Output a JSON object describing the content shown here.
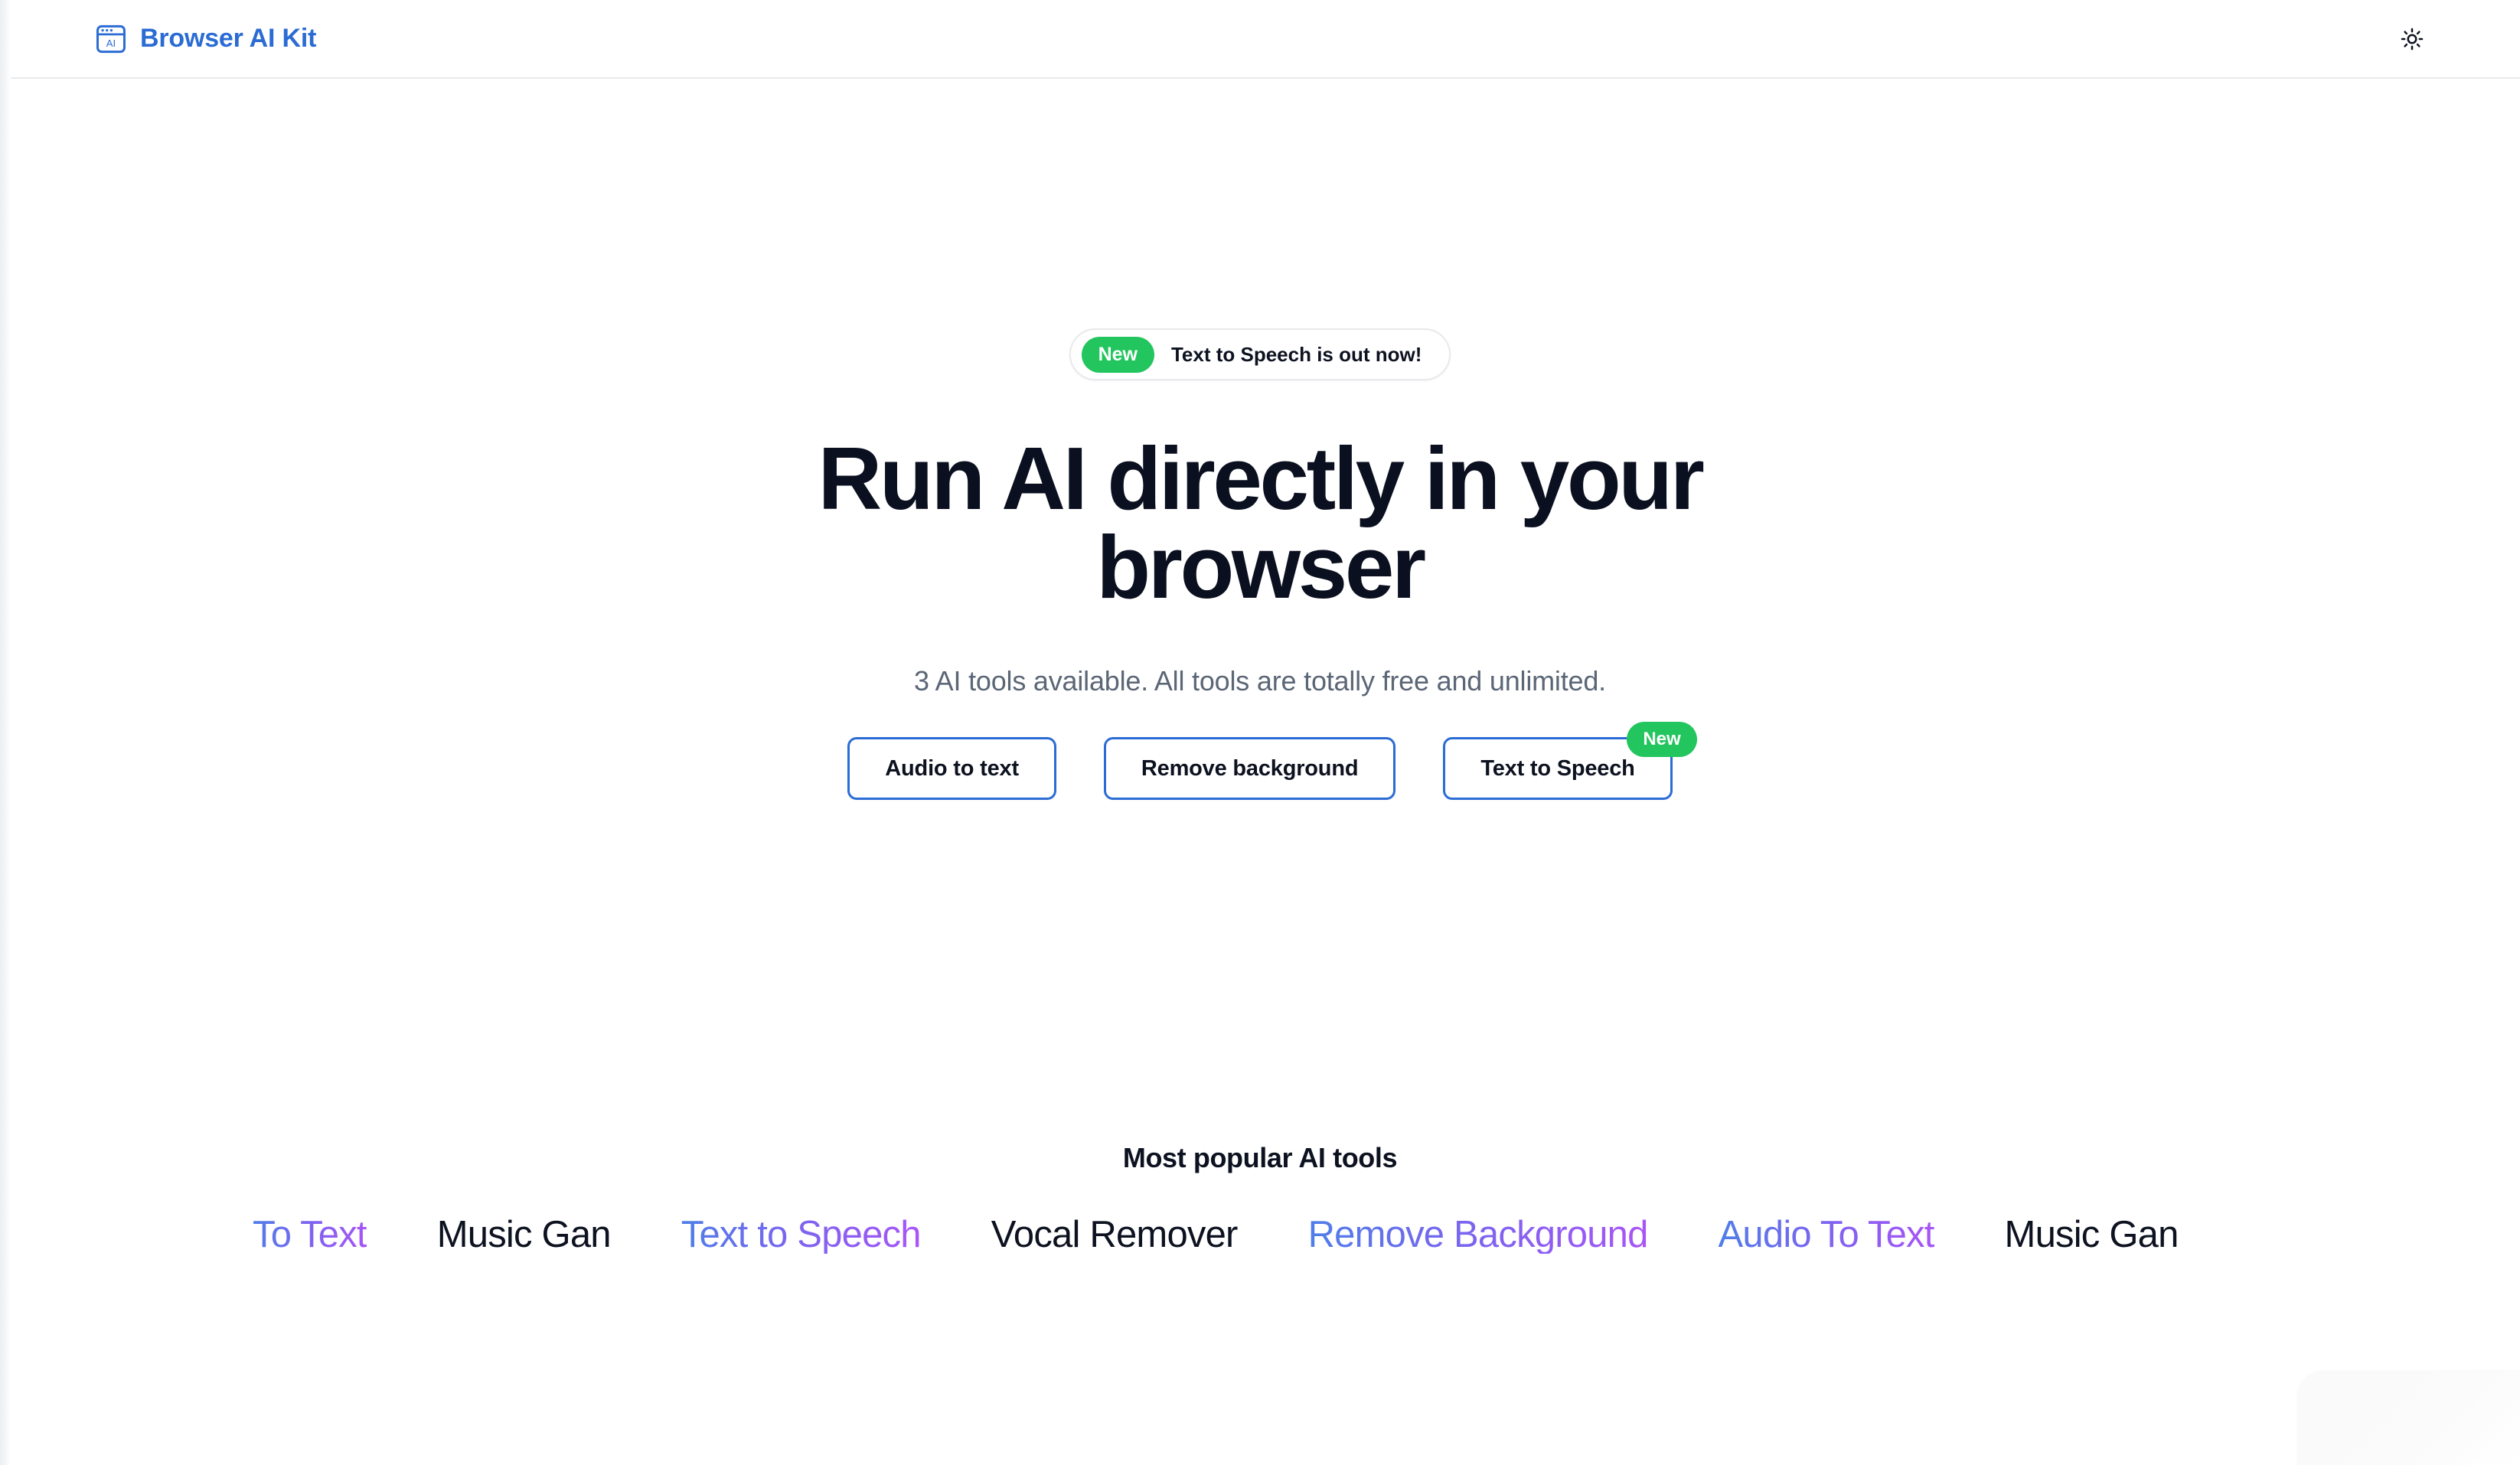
{
  "header": {
    "brand_name": "Browser AI Kit",
    "brand_icon": "browser-ai-logo-icon",
    "theme_toggle_icon": "sun-icon"
  },
  "hero": {
    "announcement": {
      "badge": "New",
      "text": "Text to Speech is out now!"
    },
    "headline": "Run AI directly in your browser",
    "subtitle": "3 AI tools available. All tools are totally free and unlimited.",
    "tool_count": 3,
    "buttons": [
      {
        "label": "Audio to text",
        "badge": null
      },
      {
        "label": "Remove background",
        "badge": null
      },
      {
        "label": "Text to Speech",
        "badge": "New"
      }
    ]
  },
  "popular": {
    "title": "Most popular AI tools",
    "items": [
      {
        "label": "To Text",
        "style": "grad"
      },
      {
        "label": "Music Gan",
        "style": "plain"
      },
      {
        "label": "Text to Speech",
        "style": "grad"
      },
      {
        "label": "Vocal Remover",
        "style": "plain"
      },
      {
        "label": "Remove Background",
        "style": "grad"
      },
      {
        "label": "Audio To Text",
        "style": "grad"
      },
      {
        "label": "Music Gan",
        "style": "plain"
      }
    ]
  },
  "colors": {
    "brand_blue": "#2b6cd4",
    "badge_green": "#22c55e",
    "headline_dark": "#0b1020",
    "subtitle_gray": "#5b6676",
    "gradient_start": "#4f7ee8",
    "gradient_end": "#a855f7"
  }
}
